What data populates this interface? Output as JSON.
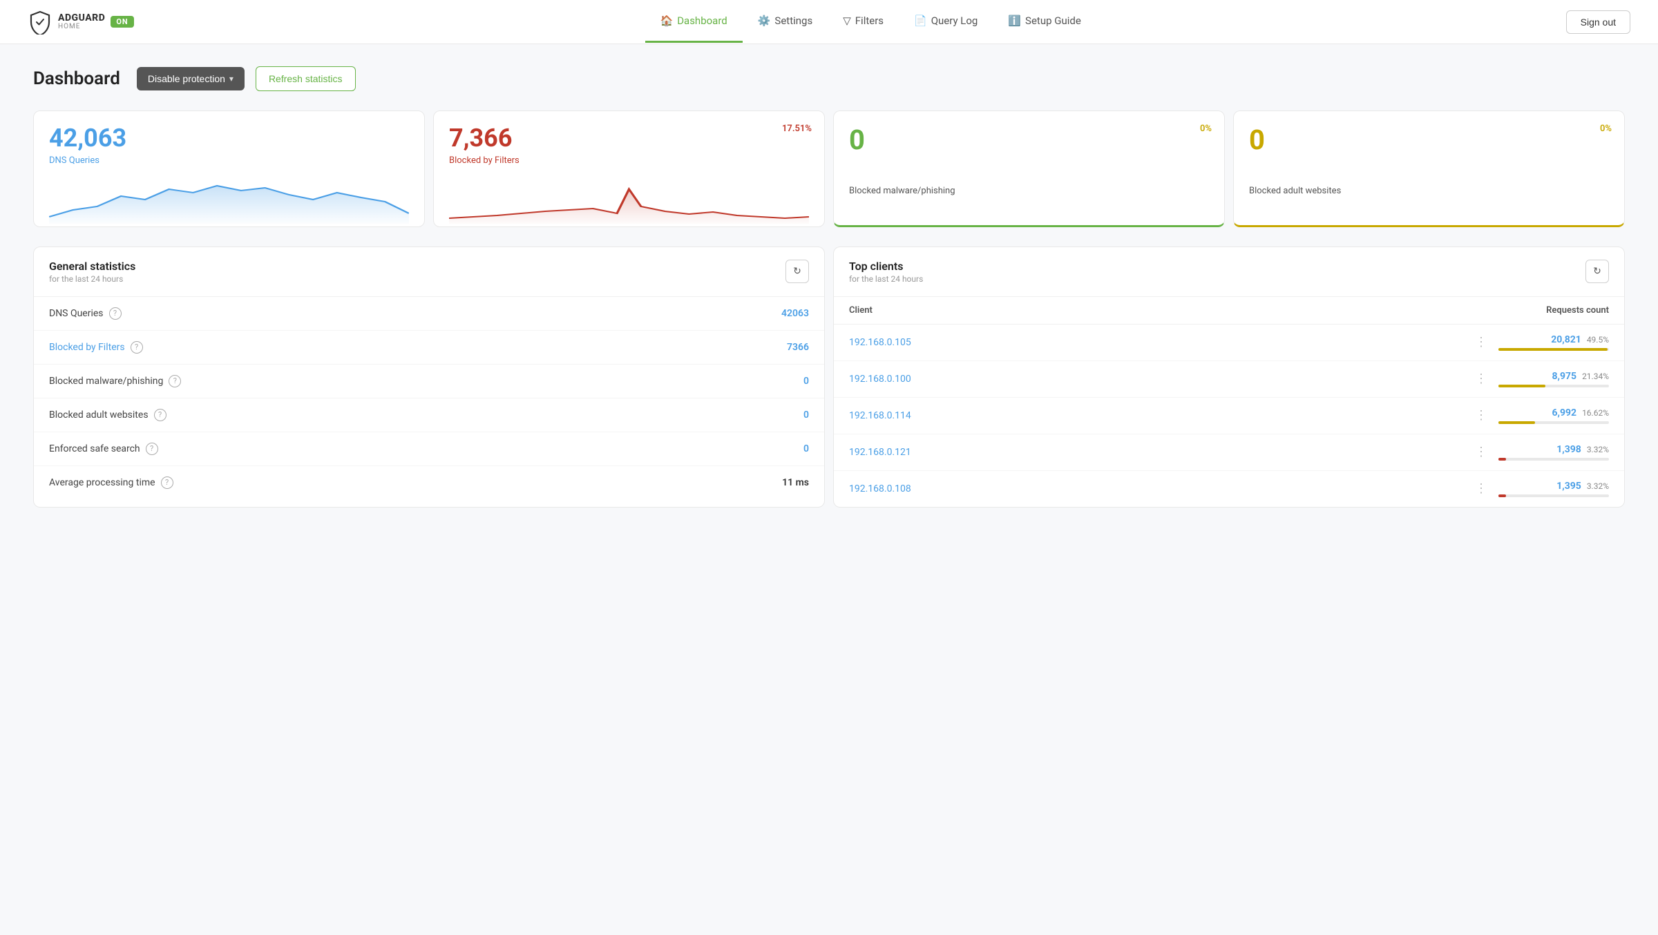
{
  "header": {
    "logo_title": "ADGUARD",
    "logo_subtitle": "HOME",
    "logo_badge": "ON",
    "nav_items": [
      {
        "id": "dashboard",
        "label": "Dashboard",
        "icon": "🏠",
        "active": true
      },
      {
        "id": "settings",
        "label": "Settings",
        "icon": "⚙️",
        "active": false
      },
      {
        "id": "filters",
        "label": "Filters",
        "icon": "⛶",
        "active": false
      },
      {
        "id": "query-log",
        "label": "Query Log",
        "icon": "📄",
        "active": false
      },
      {
        "id": "setup-guide",
        "label": "Setup Guide",
        "icon": "ℹ️",
        "active": false
      }
    ],
    "sign_out_label": "Sign out"
  },
  "dashboard": {
    "title": "Dashboard",
    "disable_btn_label": "Disable protection",
    "refresh_btn_label": "Refresh statistics"
  },
  "stat_cards": [
    {
      "id": "dns-queries",
      "number": "42,063",
      "label": "DNS Queries",
      "number_color": "#4b9fe6",
      "label_color": "#4b9fe6",
      "percent": null,
      "percent_color": null,
      "chart_color": "#4b9fe6",
      "chart_fill": "rgba(75,159,230,0.15)",
      "chart_type": "dns"
    },
    {
      "id": "blocked-by-filters",
      "number": "7,366",
      "label": "Blocked by Filters",
      "number_color": "#c0392b",
      "label_color": "#c0392b",
      "percent": "17.51%",
      "percent_color": "#c0392b",
      "chart_color": "#c0392b",
      "chart_fill": "rgba(192,57,43,0.12)",
      "chart_type": "blocked"
    },
    {
      "id": "blocked-malware",
      "number": "0",
      "label": "Blocked malware/phishing",
      "number_color": "#67b346",
      "label_color": "#555",
      "percent": "0%",
      "percent_color": "#c8a800",
      "chart_color": null,
      "chart_type": "empty"
    },
    {
      "id": "blocked-adult",
      "number": "0",
      "label": "Blocked adult websites",
      "number_color": "#c8a800",
      "label_color": "#555",
      "percent": "0%",
      "percent_color": "#c8a800",
      "chart_color": null,
      "chart_type": "empty"
    }
  ],
  "general_stats": {
    "panel_title": "General statistics",
    "panel_subtitle": "for the last 24 hours",
    "rows": [
      {
        "id": "dns-queries",
        "label": "DNS Queries",
        "value": "42063",
        "value_color": "#4b9fe6",
        "link": false
      },
      {
        "id": "blocked-by-filters",
        "label": "Blocked by Filters",
        "value": "7366",
        "value_color": "#4b9fe6",
        "link": true
      },
      {
        "id": "blocked-malware",
        "label": "Blocked malware/phishing",
        "value": "0",
        "value_color": "#4b9fe6",
        "link": false
      },
      {
        "id": "blocked-adult",
        "label": "Blocked adult websites",
        "value": "0",
        "value_color": "#4b9fe6",
        "link": false
      },
      {
        "id": "enforced-safe-search",
        "label": "Enforced safe search",
        "value": "0",
        "value_color": "#4b9fe6",
        "link": false
      },
      {
        "id": "avg-processing",
        "label": "Average processing time",
        "value": "11 ms",
        "value_color": "#333",
        "link": false
      }
    ]
  },
  "top_clients": {
    "panel_title": "Top clients",
    "panel_subtitle": "for the last 24 hours",
    "col_client": "Client",
    "col_requests": "Requests count",
    "clients": [
      {
        "ip": "192.168.0.105",
        "count": "20,821",
        "pct": "49.5%",
        "bar_pct": 49.5,
        "bar_color": "#c8a800"
      },
      {
        "ip": "192.168.0.100",
        "count": "8,975",
        "pct": "21.34%",
        "bar_pct": 21.34,
        "bar_color": "#c8a800"
      },
      {
        "ip": "192.168.0.114",
        "count": "6,992",
        "pct": "16.62%",
        "bar_pct": 16.62,
        "bar_color": "#c8a800"
      },
      {
        "ip": "192.168.0.121",
        "count": "1,398",
        "pct": "3.32%",
        "bar_pct": 3.32,
        "bar_color": "#c0392b"
      },
      {
        "ip": "192.168.0.108",
        "count": "1,395",
        "pct": "3.32%",
        "bar_pct": 3.32,
        "bar_color": "#c0392b"
      }
    ]
  }
}
